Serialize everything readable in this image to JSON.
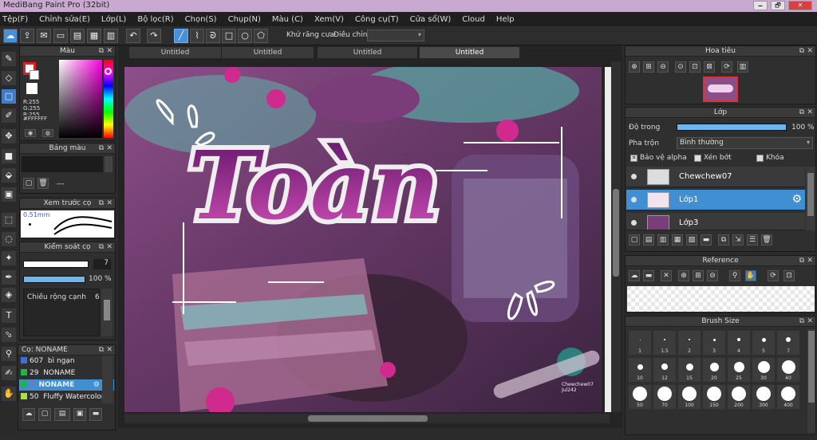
{
  "window": {
    "title": "MediBang Paint Pro (32bit)",
    "min": "🗕",
    "max": "🗗",
    "close": "✕"
  },
  "menu": [
    "Tệp(F)",
    "Chỉnh sửa(E)",
    "Lớp(L)",
    "Bộ lọc(R)",
    "Chọn(S)",
    "Chụp(N)",
    "Màu (C)",
    "Xem(V)",
    "Công cụ(T)",
    "Cửa sổ(W)",
    "Cloud",
    "Help"
  ],
  "toolbar": {
    "antialias_label": "Khử răng cưa",
    "adjust_label": "Điều chỉnh"
  },
  "color_panel": {
    "title": "Màu",
    "r": "R:255",
    "g": "G:255",
    "b": "B:255",
    "hex": "#FFFFFF"
  },
  "palette_panel": {
    "title": "Bảng màu",
    "dash": "---"
  },
  "brush_preview_panel": {
    "title": "Xem trước cọ",
    "size": "0.51mm"
  },
  "brush_control_panel": {
    "title": "Kiểm soát cọ",
    "size_value": "7",
    "opacity_value": "100 %",
    "width_label": "Chiều rộng cạnh",
    "width_value": "6"
  },
  "brush_list": {
    "title": "Cọ: NONAME",
    "items": [
      {
        "size": "607",
        "name": "bì ngạn",
        "color": "#3d6fe0"
      },
      {
        "size": "29",
        "name": "NONAME",
        "color": "#22b24c"
      },
      {
        "size": "7",
        "name": "NONAME",
        "color": "#22b24c"
      },
      {
        "size": "50",
        "name": "Fluffy Watercolor",
        "color": "#a8e04a"
      }
    ]
  },
  "tabs": [
    "Untitled",
    "Untitled",
    "Untitled",
    "Untitled"
  ],
  "artwork": {
    "word": "Toàn",
    "watermark_line1": "Chewchew07",
    "watermark_line2": "Jul242"
  },
  "navigator": {
    "title": "Hoa tiêu"
  },
  "layer_panel": {
    "title": "Lớp",
    "opacity_label": "Độ trong",
    "opacity_value": "100 %",
    "blend_label": "Pha trộn",
    "blend_value": "Bình thường",
    "alpha_label": "Bảo vệ alpha",
    "clip_label": "Xén bớt",
    "lock_label": "Khóa",
    "layers": [
      {
        "name": "Chewchew07"
      },
      {
        "name": "Lớp1"
      },
      {
        "name": "Lớp3"
      }
    ]
  },
  "reference_panel": {
    "title": "Reference"
  },
  "brush_size_panel": {
    "title": "Brush Size",
    "row1": [
      "1",
      "1.5",
      "2",
      "3",
      "4",
      "5",
      "7"
    ],
    "row2": [
      "10",
      "12",
      "15",
      "20",
      "25",
      "30",
      "40"
    ],
    "row3": [
      "50",
      "70",
      "100",
      "150",
      "200",
      "300",
      "400"
    ]
  }
}
